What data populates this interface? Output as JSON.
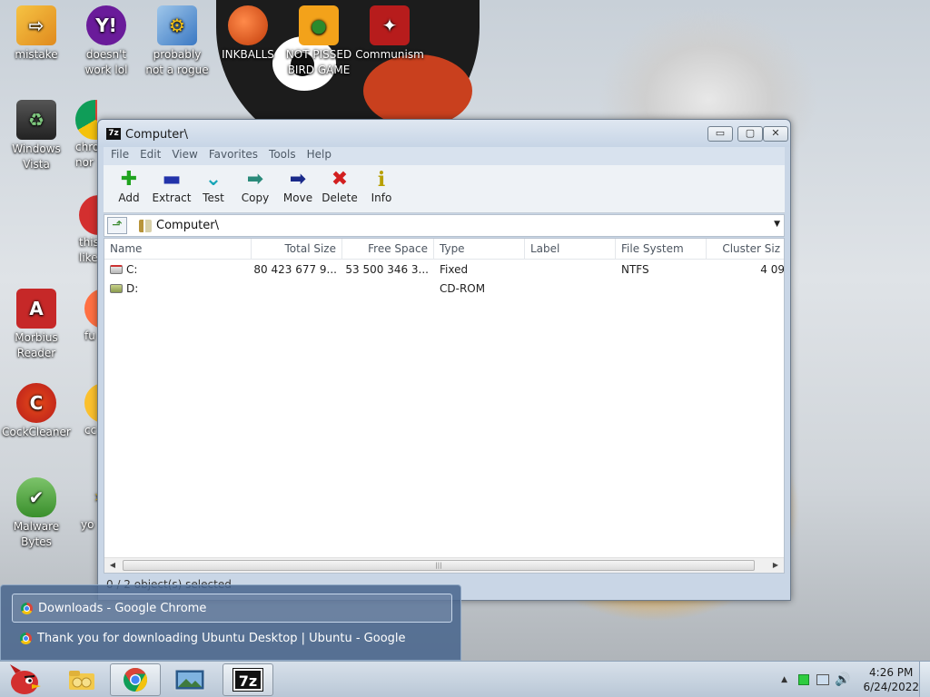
{
  "desktop": {
    "icons": [
      {
        "label_1": "mistake",
        "label_2": ""
      },
      {
        "label_1": "doesn't",
        "label_2": "work lol"
      },
      {
        "label_1": "probably",
        "label_2": "not a rogue"
      },
      {
        "label_1": "INKBALLS",
        "label_2": ""
      },
      {
        "label_1": "NOT PISSED",
        "label_2": "BIRD GAME"
      },
      {
        "label_1": "Communism",
        "label_2": ""
      },
      {
        "label_1": "Windows",
        "label_2": "Vista"
      },
      {
        "label_1": "chro",
        "label_2": "nor"
      },
      {
        "label_1": "this",
        "label_2": "like"
      },
      {
        "label_1": "Morbius",
        "label_2": "Reader"
      },
      {
        "label_1": "fu",
        "label_2": ""
      },
      {
        "label_1": "CockCleaner",
        "label_2": ""
      },
      {
        "label_1": "cc",
        "label_2": ""
      },
      {
        "label_1": "Malware",
        "label_2": "Bytes"
      },
      {
        "label_1": "yo",
        "label_2": ""
      }
    ]
  },
  "window": {
    "title": "Computer\\",
    "app_icon_text": "7z",
    "caption_buttons": {
      "minimize": "▭",
      "maximize": "▢",
      "close": "✕"
    },
    "menu": [
      "File",
      "Edit",
      "View",
      "Favorites",
      "Tools",
      "Help"
    ],
    "toolbar": [
      {
        "label": "Add",
        "icon": "add-icon",
        "glyph": "✚",
        "color": "#1fa31f"
      },
      {
        "label": "Extract",
        "icon": "extract-icon",
        "glyph": "▬",
        "color": "#2233aa"
      },
      {
        "label": "Test",
        "icon": "test-icon",
        "glyph": "⌄",
        "color": "#19a6b8"
      },
      {
        "label": "Copy",
        "icon": "copy-icon",
        "glyph": "➡",
        "color": "#2a8a7a"
      },
      {
        "label": "Move",
        "icon": "move-icon",
        "glyph": "➡",
        "color": "#1a2a8a"
      },
      {
        "label": "Delete",
        "icon": "delete-icon",
        "glyph": "✖",
        "color": "#d21f1f"
      },
      {
        "label": "Info",
        "icon": "info-icon",
        "glyph": "i",
        "color": "#b8a000"
      }
    ],
    "address": "Computer\\",
    "columns": [
      "Name",
      "Total Size",
      "Free Space",
      "Type",
      "Label",
      "File System",
      "Cluster Siz"
    ],
    "rows": [
      {
        "name": "C:",
        "total": "80 423 677 9...",
        "free": "53 500 346 3...",
        "type": "Fixed",
        "label": "",
        "fs": "NTFS",
        "cluster": "4 09",
        "icon": "hdd"
      },
      {
        "name": "D:",
        "total": "",
        "free": "",
        "type": "CD-ROM",
        "label": "",
        "fs": "",
        "cluster": "",
        "icon": "cd"
      }
    ],
    "status": "0 / 2 object(s) selected"
  },
  "popup": {
    "items": [
      "Downloads - Google Chrome",
      "Thank you for downloading Ubuntu Desktop | Ubuntu - Google Chrome"
    ]
  },
  "taskbar": {
    "time": "4:26 PM",
    "date": "6/24/2022",
    "seven_zip_label": "7z"
  }
}
